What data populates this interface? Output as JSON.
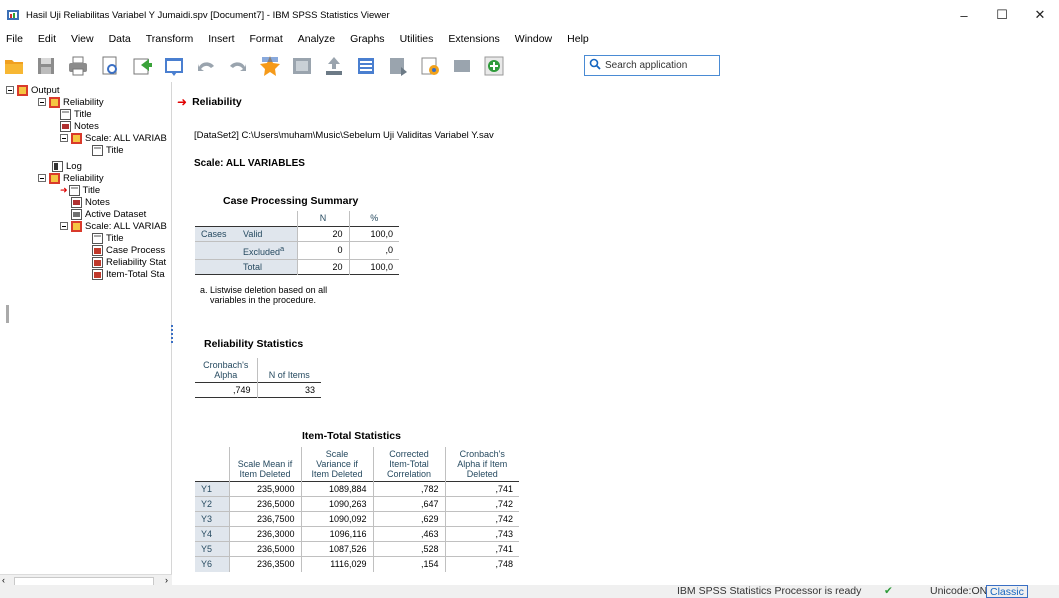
{
  "window": {
    "title": "Hasil Uji Reliabilitas Variabel Y Jumaidi.spv [Document7] - IBM SPSS Statistics Viewer",
    "minimize": "–",
    "maximize": "☐",
    "close": "✕"
  },
  "menu": [
    "File",
    "Edit",
    "View",
    "Data",
    "Transform",
    "Insert",
    "Format",
    "Analyze",
    "Graphs",
    "Utilities",
    "Extensions",
    "Window",
    "Help"
  ],
  "search": {
    "placeholder": "Search application"
  },
  "tree": [
    {
      "label": "Output"
    },
    {
      "label": "Reliability"
    },
    {
      "label": "Title"
    },
    {
      "label": "Notes"
    },
    {
      "label": "Scale: ALL VARIAB"
    },
    {
      "label": "Title"
    },
    {
      "label": "Log"
    },
    {
      "label": "Reliability"
    },
    {
      "label": "Title"
    },
    {
      "label": "Notes"
    },
    {
      "label": "Active Dataset"
    },
    {
      "label": "Scale: ALL VARIAB"
    },
    {
      "label": "Title"
    },
    {
      "label": "Case Process"
    },
    {
      "label": "Reliability Stat"
    },
    {
      "label": "Item-Total Sta"
    }
  ],
  "output": {
    "heading": "Reliability",
    "dataset": "[DataSet2] C:\\Users\\muham\\Music\\Sebelum Uji Validitas Variabel Y.sav",
    "scale": "Scale: ALL VARIABLES",
    "case_summary": {
      "title": "Case Processing Summary",
      "col_n": "N",
      "col_pct": "%",
      "group": "Cases",
      "rows": [
        {
          "label": "Valid",
          "sup": "",
          "n": "20",
          "pct": "100,0"
        },
        {
          "label": "Excluded",
          "sup": "a",
          "n": "0",
          "pct": ",0"
        },
        {
          "label": "Total",
          "sup": "",
          "n": "20",
          "pct": "100,0"
        }
      ],
      "footnote_line1": "a. Listwise deletion based on all",
      "footnote_line2": "variables in the procedure."
    },
    "reliability": {
      "title": "Reliability Statistics",
      "col1_line1": "Cronbach's",
      "col1_line2": "Alpha",
      "col2": "N of Items",
      "alpha": ",749",
      "n_items": "33"
    },
    "item_total": {
      "title": "Item-Total Statistics",
      "h1_line1": "Scale Mean if",
      "h1_line2": "Item Deleted",
      "h2_line1": "Scale",
      "h2_line2": "Variance if",
      "h2_line3": "Item Deleted",
      "h3_line1": "Corrected",
      "h3_line2": "Item-Total",
      "h3_line3": "Correlation",
      "h4_line1": "Cronbach's",
      "h4_line2": "Alpha if Item",
      "h4_line3": "Deleted",
      "rows": [
        {
          "item": "Y1",
          "mean": "235,9000",
          "var": "1089,884",
          "corr": ",782",
          "alpha": ",741"
        },
        {
          "item": "Y2",
          "mean": "236,5000",
          "var": "1090,263",
          "corr": ",647",
          "alpha": ",742"
        },
        {
          "item": "Y3",
          "mean": "236,7500",
          "var": "1090,092",
          "corr": ",629",
          "alpha": ",742"
        },
        {
          "item": "Y4",
          "mean": "236,3000",
          "var": "1096,116",
          "corr": ",463",
          "alpha": ",743"
        },
        {
          "item": "Y5",
          "mean": "236,5000",
          "var": "1087,526",
          "corr": ",528",
          "alpha": ",741"
        },
        {
          "item": "Y6",
          "mean": "236,3500",
          "var": "1116,029",
          "corr": ",154",
          "alpha": ",748"
        }
      ]
    }
  },
  "status": {
    "processor": "IBM SPSS Statistics Processor is ready",
    "unicode": "Unicode:ON",
    "classic": "Classic"
  },
  "colors": {
    "accent": "#1565c0",
    "header_text": "#264a60",
    "shade": "#e0e6ed",
    "arrow": "#e00000"
  }
}
